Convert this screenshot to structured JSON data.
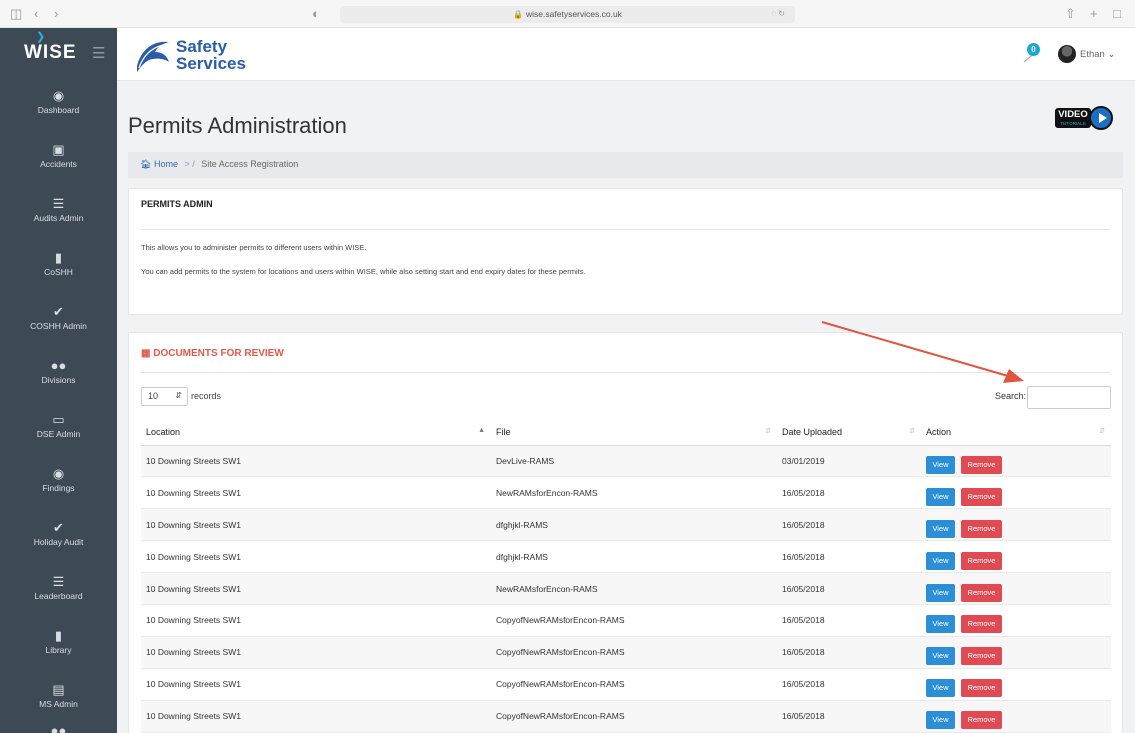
{
  "browser": {
    "url": "wise.safetyservices.co.uk"
  },
  "header": {
    "app_name": "WISE",
    "company_line1": "Safety",
    "company_line2": "Services",
    "notification_count": "0",
    "user_name": "Ethan ⌄"
  },
  "sidebar": {
    "items": [
      {
        "label": "Dashboard",
        "icon": "dashboard-icon"
      },
      {
        "label": "Accidents",
        "icon": "first-aid-icon"
      },
      {
        "label": "Audits Admin",
        "icon": "list-icon"
      },
      {
        "label": "CoSHH",
        "icon": "book-icon"
      },
      {
        "label": "COSHH Admin",
        "icon": "check-icon"
      },
      {
        "label": "Divisions",
        "icon": "users-icon"
      },
      {
        "label": "DSE Admin",
        "icon": "monitor-icon"
      },
      {
        "label": "Findings",
        "icon": "eye-icon"
      },
      {
        "label": "Holiday Audit",
        "icon": "check-icon"
      },
      {
        "label": "Leaderboard",
        "icon": "list-icon"
      },
      {
        "label": "Library",
        "icon": "book-icon"
      },
      {
        "label": "MS Admin",
        "icon": "list-icon"
      }
    ]
  },
  "main": {
    "title": "Permits Administration",
    "video_label": "VIDEO",
    "video_sub": "TUTORIALS",
    "breadcrumb": {
      "home": "Home",
      "current": "Site Access Registration"
    },
    "info": {
      "heading": "PERMITS ADMIN",
      "line1": "This allows you to administer permits to different users within WISE.",
      "line2": "You can add permits to the system for locations and users within WISE, while also setting start and end expiry dates for these permits."
    },
    "docs": {
      "heading": "DOCUMENTS FOR REVIEW",
      "records_value": "10",
      "records_label": "records",
      "search_label": "Search:",
      "columns": [
        "Location",
        "File",
        "Date Uploaded",
        "Action"
      ],
      "view_label": "View",
      "remove_label": "Remove",
      "rows": [
        {
          "location": "10 Downing Streets SW1",
          "file": "DevLive-RAMS",
          "date": "03/01/2019"
        },
        {
          "location": "10 Downing Streets SW1",
          "file": "NewRAMsforEncon-RAMS",
          "date": "16/05/2018"
        },
        {
          "location": "10 Downing Streets SW1",
          "file": "dfghjkl-RAMS",
          "date": "16/05/2018"
        },
        {
          "location": "10 Downing Streets SW1",
          "file": "dfghjkl-RAMS",
          "date": "16/05/2018"
        },
        {
          "location": "10 Downing Streets SW1",
          "file": "NewRAMsforEncon-RAMS",
          "date": "16/05/2018"
        },
        {
          "location": "10 Downing Streets SW1",
          "file": "CopyofNewRAMsforEncon-RAMS",
          "date": "16/05/2018"
        },
        {
          "location": "10 Downing Streets SW1",
          "file": "CopyofNewRAMsforEncon-RAMS",
          "date": "16/05/2018"
        },
        {
          "location": "10 Downing Streets SW1",
          "file": "CopyofNewRAMsforEncon-RAMS",
          "date": "16/05/2018"
        },
        {
          "location": "10 Downing Streets SW1",
          "file": "CopyofNewRAMsforEncon-RAMS",
          "date": "16/05/2018"
        }
      ]
    }
  },
  "colors": {
    "sidebar": "#3d4a56",
    "accent_blue": "#2d8ed8",
    "remove_red": "#e04a53",
    "docs_heading": "#e05a4a",
    "annotation_arrow": "#e2553f"
  }
}
